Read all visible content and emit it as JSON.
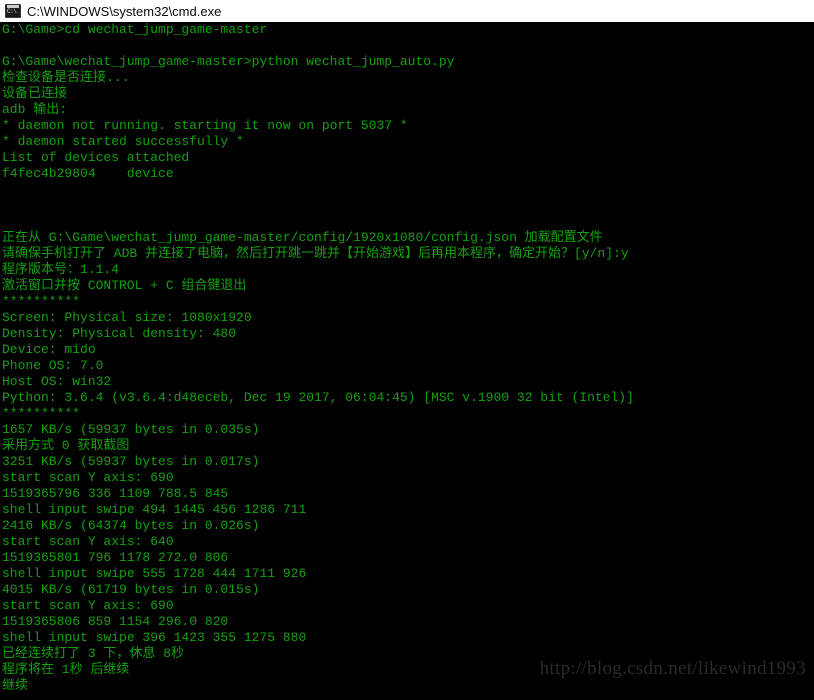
{
  "window": {
    "title": "C:\\WINDOWS\\system32\\cmd.exe",
    "icon": "cmd-console-icon",
    "titlebar_bg": "#ffffff",
    "titlebar_fg": "#0a0a0a",
    "console_bg": "#000000",
    "console_fg": "#13a10e"
  },
  "watermark": {
    "text": "http://blog.csdn.net/likewind1993",
    "color": "#2a2a2a"
  },
  "console": {
    "lines": [
      "G:\\Game>cd wechat_jump_game-master",
      "",
      "G:\\Game\\wechat_jump_game-master>python wechat_jump_auto.py",
      "检查设备是否连接...",
      "设备已连接",
      "adb 输出:",
      "* daemon not running. starting it now on port 5037 *",
      "* daemon started successfully *",
      "List of devices attached",
      "f4fec4b29804    device",
      "",
      "",
      "",
      "正在从 G:\\Game\\wechat_jump_game-master/config/1920x1080/config.json 加载配置文件",
      "请确保手机打开了 ADB 并连接了电脑，然后打开跳一跳并【开始游戏】后再用本程序，确定开始？[y/n]:y",
      "程序版本号：1.1.4",
      "激活窗口并按 CONTROL + C 组合键退出",
      "**********",
      "Screen: Physical size: 1080x1920",
      "Density: Physical density: 480",
      "Device: mido",
      "Phone OS: 7.0",
      "Host OS: win32",
      "Python: 3.6.4 (v3.6.4:d48eceb, Dec 19 2017, 06:04:45) [MSC v.1900 32 bit (Intel)]",
      "**********",
      "1657 KB/s (59937 bytes in 0.035s)",
      "采用方式 0 获取截图",
      "3251 KB/s (59937 bytes in 0.017s)",
      "start scan Y axis: 690",
      "1519365796 336 1109 788.5 845",
      "shell input swipe 494 1445 456 1286 711",
      "2416 KB/s (64374 bytes in 0.026s)",
      "start scan Y axis: 640",
      "1519365801 796 1178 272.0 806",
      "shell input swipe 555 1728 444 1711 926",
      "4015 KB/s (61719 bytes in 0.015s)",
      "start scan Y axis: 690",
      "1519365806 859 1154 296.0 820",
      "shell input swipe 396 1423 355 1275 880",
      "已经连续打了 3 下，休息 8秒",
      "程序将在 1秒 后继续",
      "继续"
    ]
  }
}
